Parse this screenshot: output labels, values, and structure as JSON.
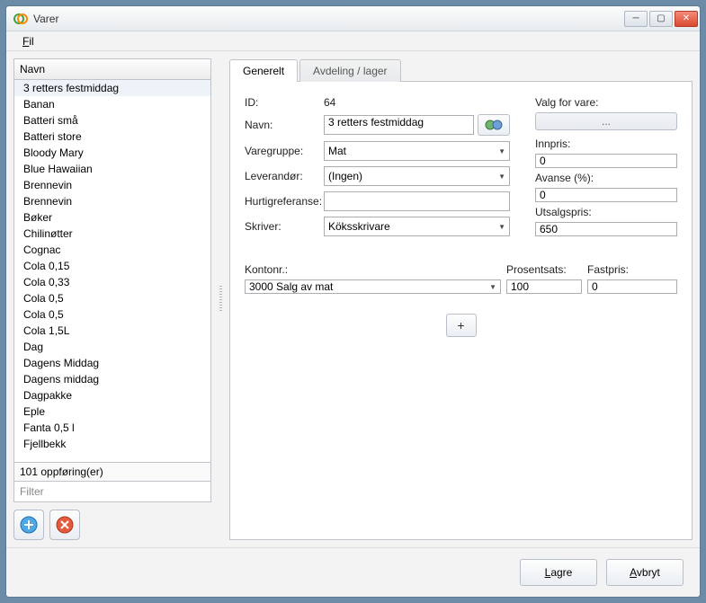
{
  "window": {
    "title": "Varer"
  },
  "menu": {
    "file": "Fil"
  },
  "list": {
    "header": "Navn",
    "items": [
      "3 retters festmiddag",
      "Banan",
      "Batteri små",
      "Batteri store",
      "Bloody Mary",
      "Blue Hawaiian",
      "Brennevin",
      "Brennevin",
      "Bøker",
      "Chilinøtter",
      "Cognac",
      "Cola 0,15",
      "Cola 0,33",
      "Cola 0,5",
      "Cola 0,5",
      "Cola 1,5L",
      "Dag",
      "Dagens Middag",
      "Dagens middag",
      "Dagpakke",
      "Eple",
      "Fanta 0,5 l",
      "Fjellbekk"
    ],
    "selected_index": 0,
    "count_text": "101 oppføring(er)",
    "filter_placeholder": "Filter"
  },
  "tabs": {
    "general": "Generelt",
    "dept": "Avdeling / lager"
  },
  "form": {
    "id_label": "ID:",
    "id_value": "64",
    "name_label": "Navn:",
    "name_value": "3 retters festmiddag",
    "group_label": "Varegruppe:",
    "group_value": "Mat",
    "vendor_label": "Leverandør:",
    "vendor_value": "(Ingen)",
    "quickref_label": "Hurtigreferanse:",
    "quickref_value": "",
    "printer_label": "Skriver:",
    "printer_value": "Köksskrivare"
  },
  "options": {
    "heading": "Valg for vare:",
    "button": "...",
    "innpris_label": "Innpris:",
    "innpris_value": "0",
    "avanse_label": "Avanse (%):",
    "avanse_value": "0",
    "utsalg_label": "Utsalgspris:",
    "utsalg_value": "650"
  },
  "account": {
    "konto_label": "Kontonr.:",
    "konto_value": "3000  Salg av mat",
    "prosent_label": "Prosentsats:",
    "prosent_value": "100",
    "fast_label": "Fastpris:",
    "fast_value": "0",
    "add": "+"
  },
  "footer": {
    "save": "Lagre",
    "cancel": "Avbryt"
  }
}
